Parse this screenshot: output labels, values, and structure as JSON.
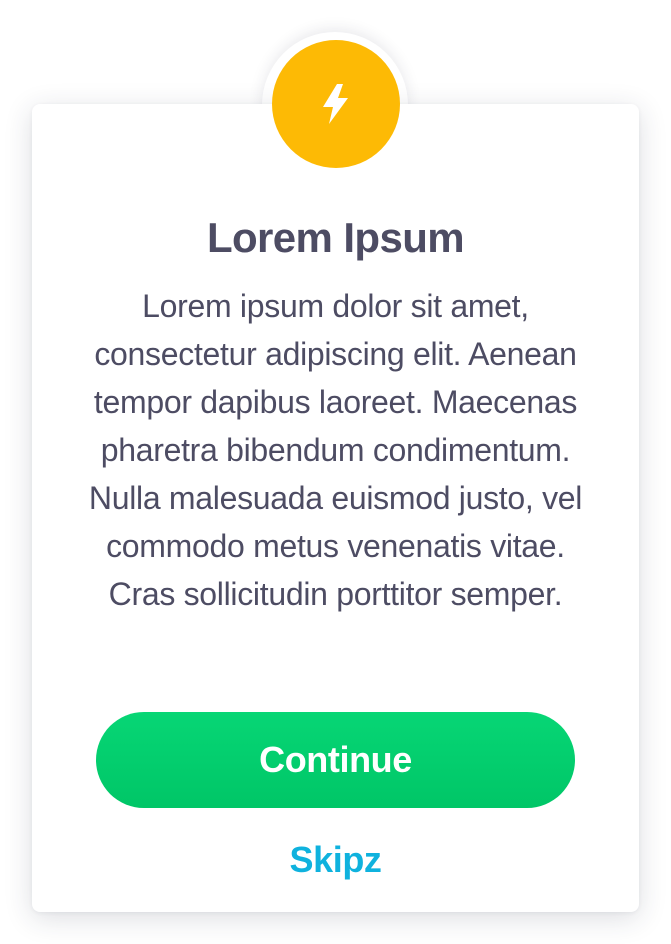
{
  "dialog": {
    "icon": "lightning-bolt-icon",
    "title": "Lorem Ipsum",
    "body": "Lorem ipsum dolor sit amet, consectetur adipiscing elit. Aenean tempor dapibus laoreet. Maecenas pharetra bibendum condimentum. Nulla malesuada euismod justo, vel commodo metus venenatis vitae. Cras sollicitudin porttitor semper.",
    "primary_button_label": "Continue",
    "secondary_link_label": "Skipz"
  },
  "colors": {
    "badge": "#fdba05",
    "text": "#4d4c63",
    "button": "#00cf6f",
    "link": "#0fb2de",
    "background": "#ffffff"
  }
}
